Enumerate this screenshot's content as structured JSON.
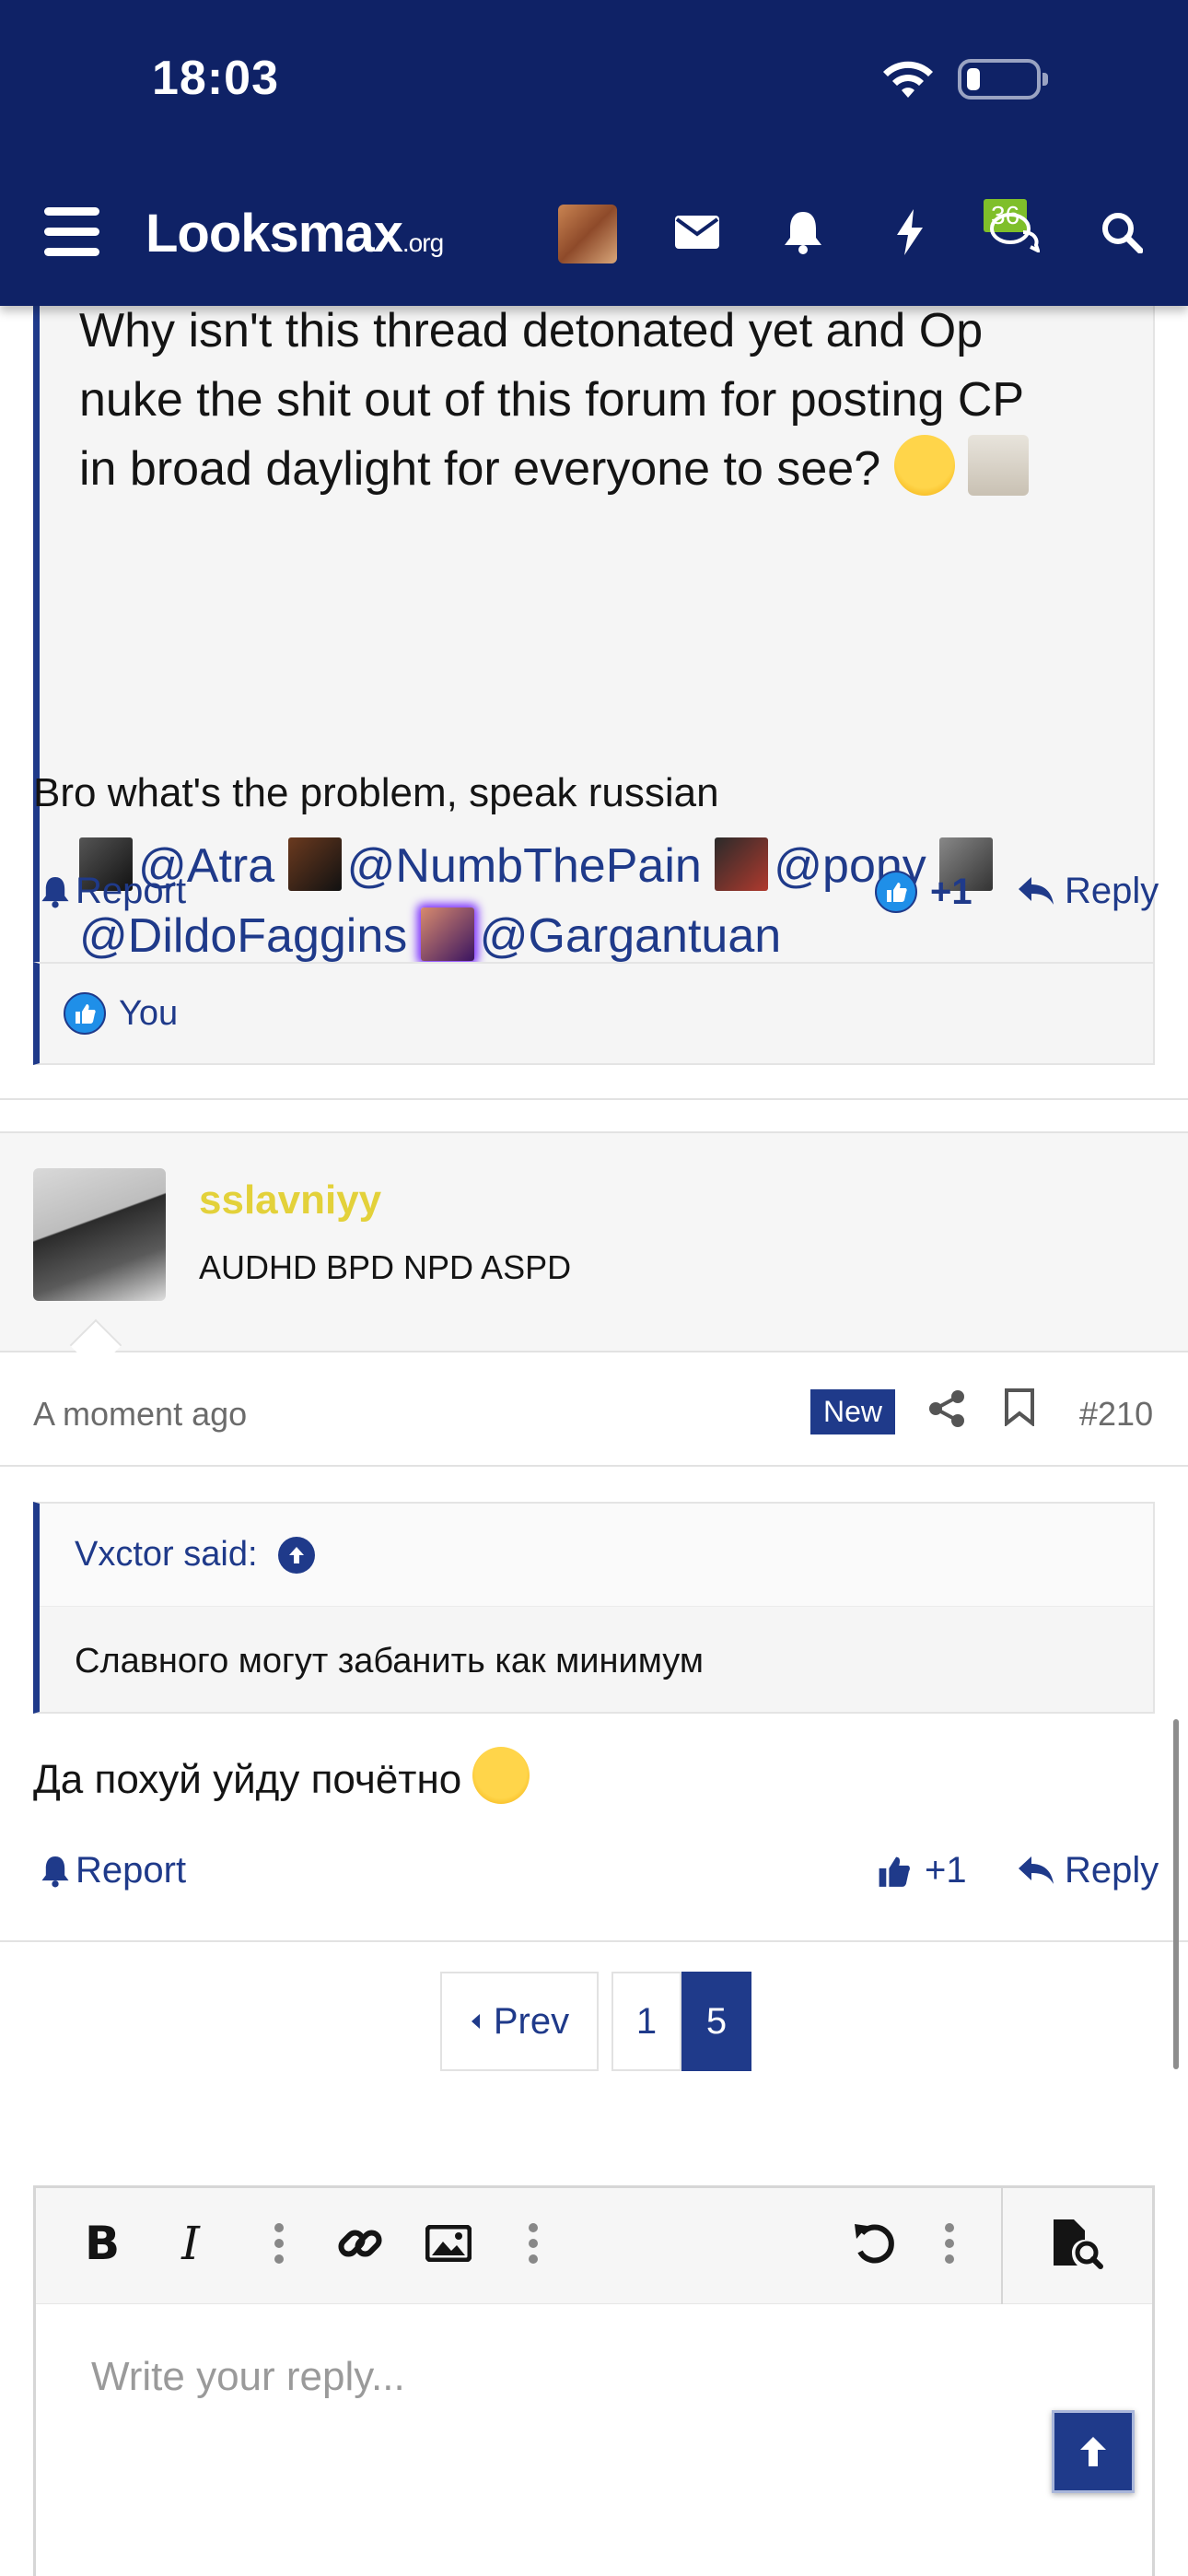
{
  "status_bar": {
    "time": "18:03"
  },
  "header": {
    "logo_main": "Looksmax",
    "logo_suffix": ".org",
    "conversations_badge": "36",
    "icons": [
      "menu-icon",
      "envelope-icon",
      "bell-icon",
      "bolt-icon",
      "conversations-icon",
      "search-icon"
    ]
  },
  "post1": {
    "quote_text": [
      "Why isn't this thread detonated yet and Op",
      "nuke the shit out of this forum for posting CP",
      "in broad daylight for everyone to see?"
    ],
    "mentions": [
      "@Atra",
      "@NumbThePain",
      "@pony",
      "@DildoFaggins",
      "@Gargantuan"
    ],
    "body": "Bro what's the problem, speak russian",
    "report_label": "Report",
    "like_count": "+1",
    "reply_label": "Reply",
    "reacted_by": "You"
  },
  "post2": {
    "username": "sslavniyy",
    "user_title": "AUDHD BPD NPD ASPD",
    "time": "A moment ago",
    "new_badge": "New",
    "post_number": "#210",
    "quote_author": "Vxctor said:",
    "quote_text": "Славного могут забанить как минимум",
    "body": "Да похуй уйду почётно",
    "report_label": "Report",
    "like_count": "+1",
    "reply_label": "Reply"
  },
  "pagination": {
    "prev_label": "Prev",
    "pages": [
      "1",
      "5"
    ],
    "current": "5"
  },
  "editor": {
    "placeholder": "Write your reply..."
  },
  "colors": {
    "brand": "#0f2266",
    "accent": "#1f3a8a",
    "username": "#e3d13a"
  }
}
